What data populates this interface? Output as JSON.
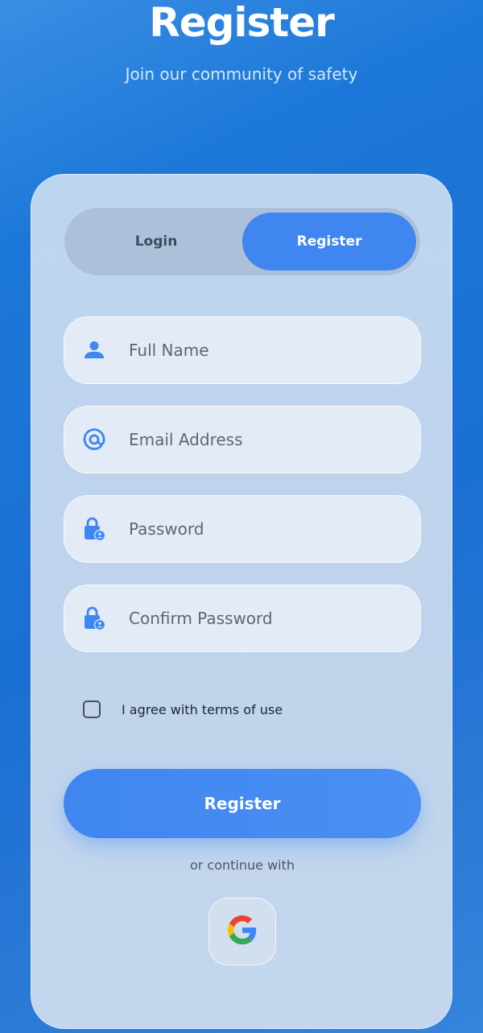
{
  "header": {
    "title": "Register",
    "subtitle": "Join our community of safety"
  },
  "tabs": {
    "login_label": "Login",
    "register_label": "Register",
    "active": "Register"
  },
  "form": {
    "full_name": {
      "placeholder": "Full Name",
      "icon": "person-icon"
    },
    "email": {
      "placeholder": "Email Address",
      "icon": "at-sign-icon"
    },
    "password": {
      "placeholder": "Password",
      "icon": "lock-person-icon"
    },
    "confirm_password": {
      "placeholder": "Confirm Password",
      "icon": "lock-person-icon"
    },
    "terms_label": "I agree with terms of use",
    "terms_checked": false,
    "submit_label": "Register"
  },
  "social": {
    "divider_text": "or continue with",
    "google_icon": "google-icon"
  },
  "colors": {
    "accent": "#3f86f0",
    "background": "#1c78d8",
    "icon": "#3f86f0"
  }
}
